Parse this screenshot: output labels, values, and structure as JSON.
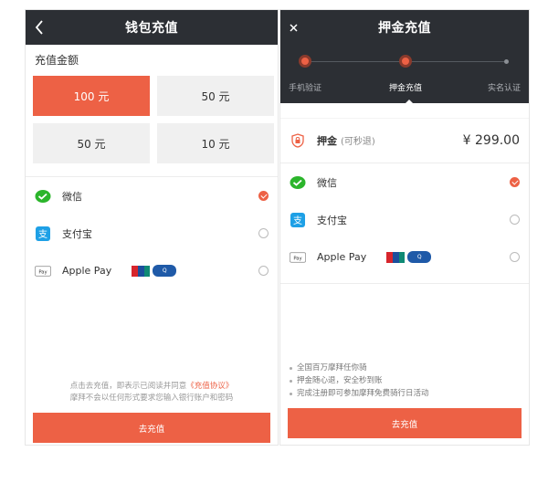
{
  "left": {
    "title": "钱包充值",
    "back_icon": "chevron-left-icon",
    "amount_header": "充值金额",
    "amounts": [
      {
        "label": "100 元",
        "selected": true
      },
      {
        "label": "50 元",
        "selected": false
      },
      {
        "label": "50 元",
        "selected": false
      },
      {
        "label": "10 元",
        "selected": false
      }
    ],
    "payment_methods": [
      {
        "label": "微信",
        "icon": "wechat-icon",
        "checked": true
      },
      {
        "label": "支付宝",
        "icon": "alipay-icon",
        "checked": false
      },
      {
        "label": "Apple Pay",
        "icon": "apple-pay-icon",
        "checked": false
      }
    ],
    "terms_line1_prefix": "点击去充值，即表示已阅读并同意",
    "terms_link": "《充值协议》",
    "terms_line2": "摩拜不会以任何形式要求您输入银行账户和密码",
    "submit_label": "去充值"
  },
  "right": {
    "title": "押金充值",
    "close_icon": "close-icon",
    "steps": [
      {
        "label": "手机验证",
        "state": "done"
      },
      {
        "label": "押金充值",
        "state": "current"
      },
      {
        "label": "实名认证",
        "state": "future"
      }
    ],
    "deposit_label": "押金",
    "deposit_sub": "(可秒退)",
    "deposit_amount": "¥ 299.00",
    "payment_methods": [
      {
        "label": "微信",
        "icon": "wechat-icon",
        "checked": true
      },
      {
        "label": "支付宝",
        "icon": "alipay-icon",
        "checked": false
      },
      {
        "label": "Apple Pay",
        "icon": "apple-pay-icon",
        "checked": false
      }
    ],
    "notes": [
      "全国百万摩拜任你骑",
      "押金随心退，安全秒到账",
      "完成注册即可参加摩拜免费骑行日活动"
    ],
    "submit_label": "去充值"
  },
  "colors": {
    "accent": "#ed6145",
    "topbar": "#2c2f34",
    "wechat": "#2bb52b",
    "alipay": "#1ea0e6"
  }
}
